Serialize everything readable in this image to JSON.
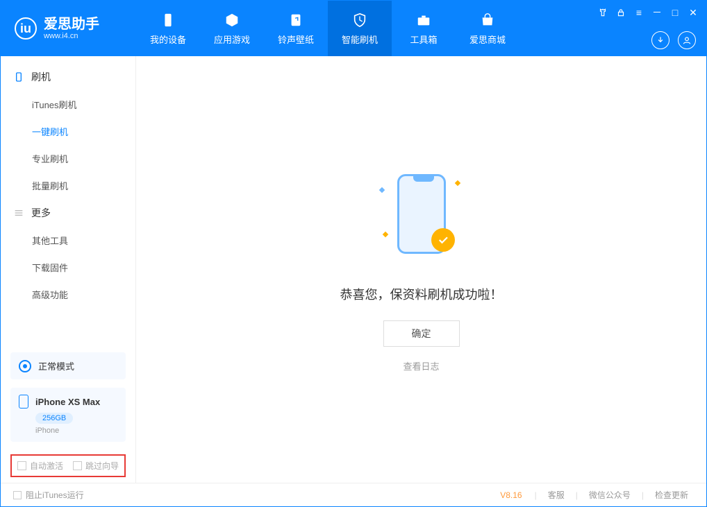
{
  "app": {
    "title": "爱思助手",
    "subtitle": "www.i4.cn"
  },
  "tabs": [
    {
      "label": "我的设备"
    },
    {
      "label": "应用游戏"
    },
    {
      "label": "铃声壁纸"
    },
    {
      "label": "智能刷机"
    },
    {
      "label": "工具箱"
    },
    {
      "label": "爱思商城"
    }
  ],
  "sidebar": {
    "section1": {
      "title": "刷机",
      "items": [
        "iTunes刷机",
        "一键刷机",
        "专业刷机",
        "批量刷机"
      ]
    },
    "section2": {
      "title": "更多",
      "items": [
        "其他工具",
        "下载固件",
        "高级功能"
      ]
    }
  },
  "mode": {
    "label": "正常模式"
  },
  "device": {
    "name": "iPhone XS Max",
    "storage": "256GB",
    "type": "iPhone"
  },
  "options": {
    "auto_activate": "自动激活",
    "skip_guide": "跳过向导"
  },
  "main": {
    "message": "恭喜您，保资料刷机成功啦！",
    "ok": "确定",
    "view_log": "查看日志"
  },
  "footer": {
    "block_itunes": "阻止iTunes运行",
    "version": "V8.16",
    "service": "客服",
    "wechat": "微信公众号",
    "check_update": "检查更新"
  }
}
